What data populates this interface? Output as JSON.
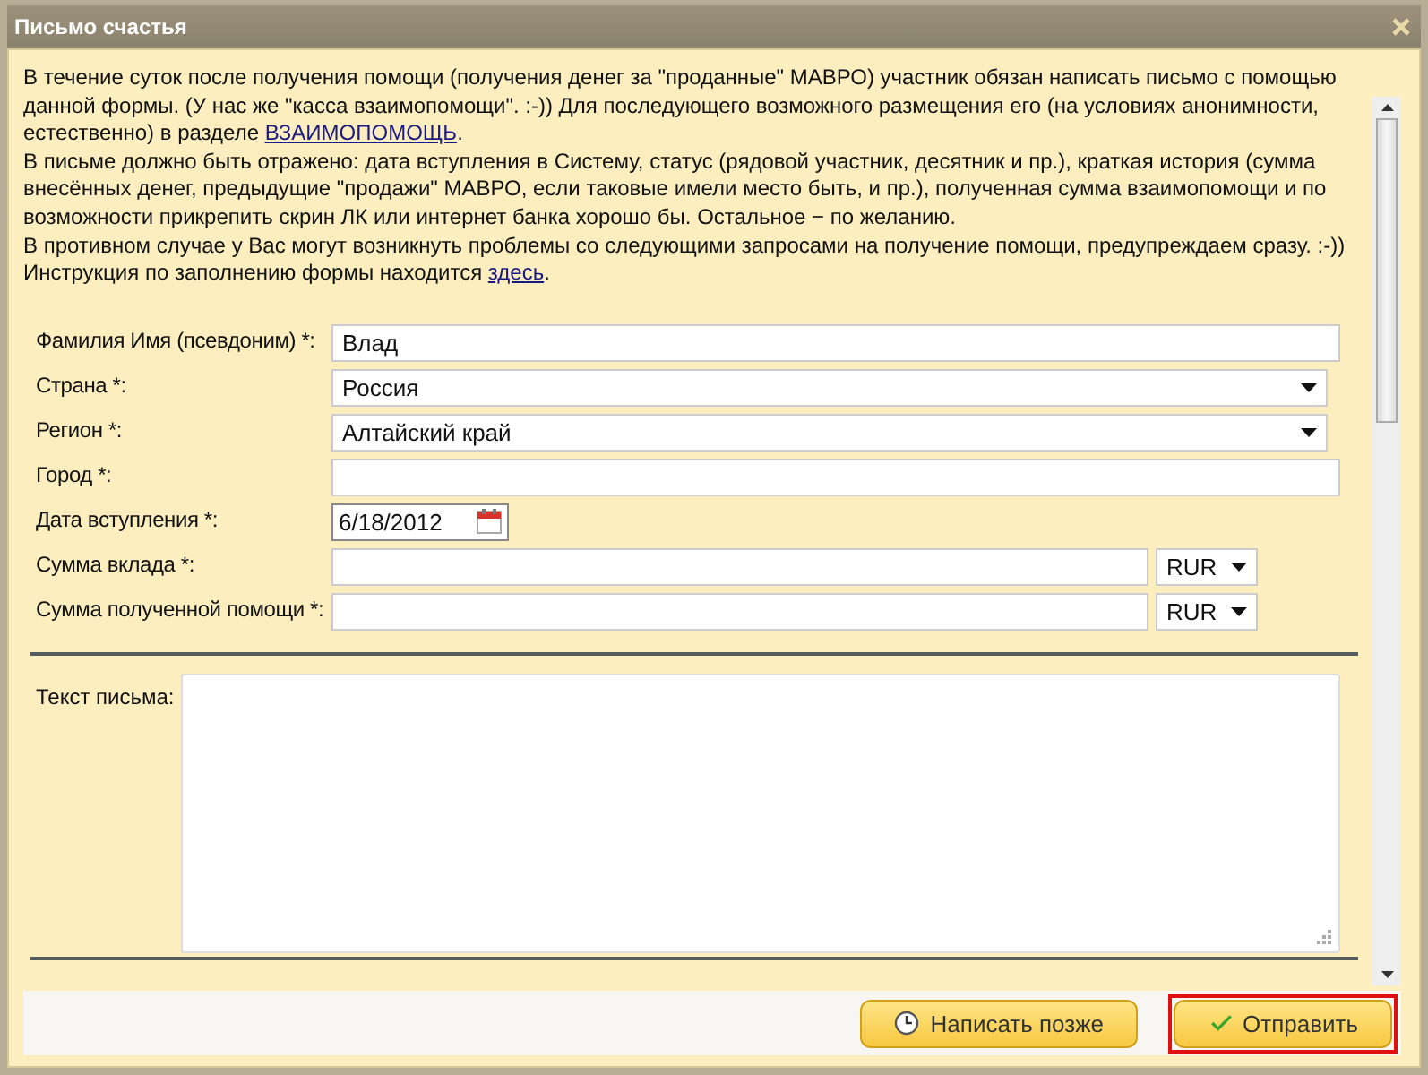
{
  "window": {
    "title": "Письмо счастья"
  },
  "intro": [
    {
      "before": "В течение суток после получения помощи (получения денег за \"проданные\" МАВРО) участник обязан написать письмо с помощью данной формы. (У нас же \"касса взаимопомощи\". :-)) Для последующего возможного размещения его (на условиях анонимности, естественно) в разделе ",
      "link": "ВЗАИМОПОМОЩЬ",
      "after": "."
    },
    {
      "before": "В письме должно быть отражено: дата вступления в Систему, статус (рядовой участник, десятник и пр.), краткая история (сумма внесённых денег, предыдущие \"продажи\" МАВРО, если таковые имели место быть, и пр.), полученная сумма взаимопомощи и по возможности прикрепить скрин ЛК или интернет банка хорошо бы. Остальное − по желанию."
    },
    {
      "before": "В противном случае у Вас могут возникнуть проблемы со следующими запросами на получение помощи, предупреждаем сразу. :-))"
    },
    {
      "before": "Инструкция по заполнению формы находится ",
      "link": "здесь",
      "after": "."
    }
  ],
  "fields": [
    {
      "kind": "text",
      "label": "Фамилия Имя (псевдоним) *:",
      "value": "Влад"
    },
    {
      "kind": "select",
      "label": "Страна *:",
      "value": "Россия"
    },
    {
      "kind": "select",
      "label": "Регион *:",
      "value": "Алтайский край"
    },
    {
      "kind": "text",
      "label": "Город *:"
    },
    {
      "kind": "date",
      "label": "Дата вступления *:",
      "value": "6/18/2012"
    },
    {
      "kind": "amount",
      "label": "Сумма вклада *:",
      "currency": "RUR"
    },
    {
      "kind": "amount",
      "label": "Сумма полученной помощи *:",
      "currency": "RUR"
    }
  ],
  "message": {
    "label": "Текст письма:"
  },
  "buttons": [
    {
      "kind": "later",
      "label": "Написать позже",
      "focused": false
    },
    {
      "kind": "send",
      "label": "Отправить",
      "focused": true
    }
  ]
}
